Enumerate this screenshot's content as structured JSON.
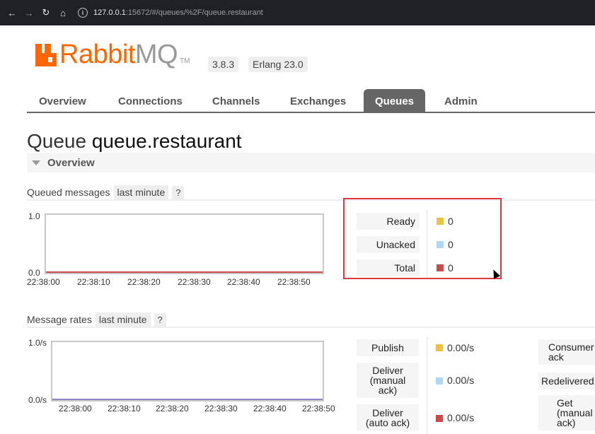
{
  "browser": {
    "url_host": "127.0.0.1",
    "url_rest": ":15672/#/queues/%2F/queue.restaurant",
    "icons": [
      "back-arrow-icon",
      "forward-arrow-icon",
      "reload-icon",
      "home-icon",
      "info-icon"
    ]
  },
  "header": {
    "logo_rabbit": "Rabbit",
    "logo_mq": "MQ",
    "logo_tm": "TM",
    "version": "3.8.3",
    "erlang": "Erlang 23.0"
  },
  "tabs": [
    {
      "label": "Overview",
      "active": false
    },
    {
      "label": "Connections",
      "active": false
    },
    {
      "label": "Channels",
      "active": false
    },
    {
      "label": "Exchanges",
      "active": false
    },
    {
      "label": "Queues",
      "active": true
    },
    {
      "label": "Admin",
      "active": false
    }
  ],
  "page": {
    "title_prefix": "Queue",
    "queue_name": "queue.restaurant",
    "section": "Overview"
  },
  "queued_messages": {
    "label": "Queued messages",
    "range": "last minute",
    "help": "?",
    "y_max": "1.0",
    "y_min": "0.0",
    "x_ticks": [
      "22:38:00",
      "22:38:10",
      "22:38:20",
      "22:38:30",
      "22:38:40",
      "22:38:50"
    ],
    "legend": [
      {
        "label": "Ready",
        "value": "0",
        "color": "#edc240"
      },
      {
        "label": "Unacked",
        "value": "0",
        "color": "#afd8f8"
      },
      {
        "label": "Total",
        "value": "0",
        "color": "#cb4b4b"
      }
    ]
  },
  "message_rates": {
    "label": "Message rates",
    "range": "last minute",
    "help": "?",
    "y_max": "1.0/s",
    "y_min": "0.0/s",
    "x_ticks": [
      "22:38:00",
      "22:38:10",
      "22:38:20",
      "22:38:30",
      "22:38:40",
      "22:38:50"
    ],
    "legend": [
      {
        "label": "Publish",
        "value": "0.00/s",
        "color": "#edc240"
      },
      {
        "label": "Deliver (manual ack)",
        "value": "0.00/s",
        "color": "#afd8f8"
      },
      {
        "label": "Deliver (auto ack)",
        "value": "0.00/s",
        "color": "#cb4b4b"
      }
    ],
    "right_column": [
      "Consumer ack",
      "Redelivered",
      "Get (manual ack)"
    ]
  },
  "colors": {
    "brand": "#ff6600",
    "active_tab": "#666666",
    "highlight": "#e0383e"
  }
}
